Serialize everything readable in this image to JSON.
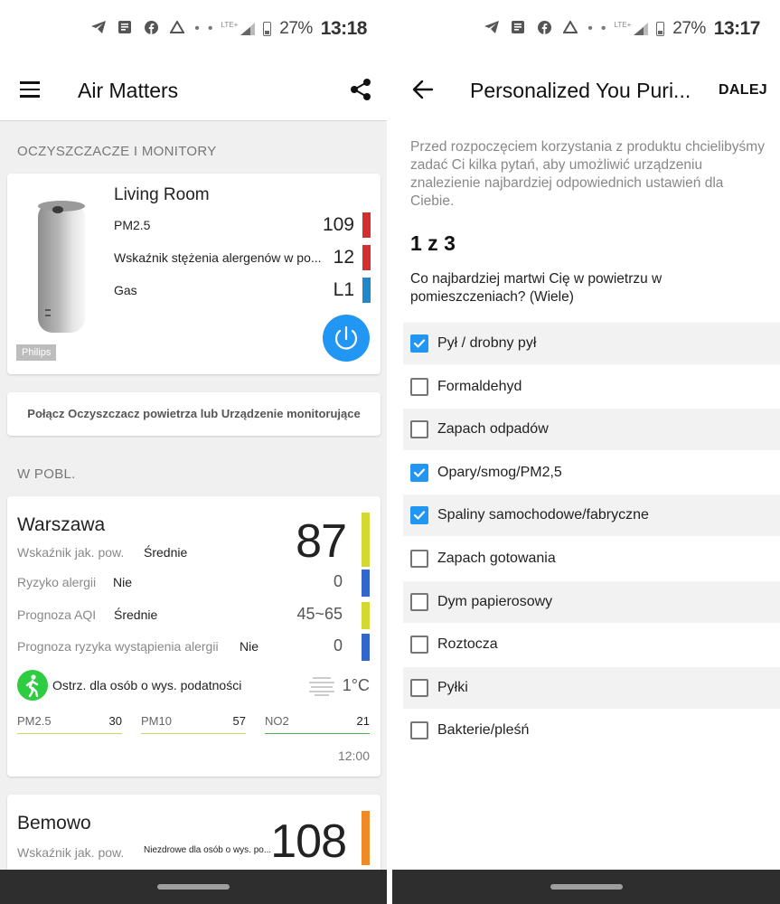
{
  "left": {
    "status": {
      "battery": "27%",
      "time": "13:18",
      "network": "LTE+"
    },
    "app_title": "Air Matters",
    "section_devices": "OCZYSZCZACZE I MONITORY",
    "device": {
      "name": "Living Room",
      "brand": "Philips",
      "rows": [
        {
          "label": "PM2.5",
          "value": "109",
          "color": "#d32f2f"
        },
        {
          "label": "Wskaźnik stężenia alergenów w po...",
          "value": "12",
          "color": "#d32f2f"
        },
        {
          "label": "Gas",
          "value": "L1",
          "color": "#1e88c8"
        }
      ]
    },
    "connect_label": "Połącz Oczyszczacz powietrza lub Urządzenie monitorujące",
    "section_nearby": "W POBL.",
    "city1": {
      "name": "Warszawa",
      "aqi": "87",
      "aqi_color": "#d4d932",
      "rows": [
        {
          "key": "Wskaźnik jak. pow.",
          "value": "Średnie",
          "num": "",
          "color": ""
        },
        {
          "key": "Ryzyko alergii",
          "value": "Nie",
          "num": "0",
          "color": "#3366cc"
        },
        {
          "key": "Prognoza AQI",
          "value": "Średnie",
          "num": "45~65",
          "color": "#d4d932"
        },
        {
          "key": "Prognoza ryzyka wystąpienia alergii",
          "value": "Nie",
          "num": "0",
          "color": "#3366cc"
        }
      ],
      "advice": "Ostrz. dla osób o wys. podatności",
      "temp": "1°C",
      "pollutants": [
        {
          "name": "PM2.5",
          "value": "30",
          "color": "#c5d96b"
        },
        {
          "name": "PM10",
          "value": "57",
          "color": "#c5d96b"
        },
        {
          "name": "NO2",
          "value": "21",
          "color": "#4caf50"
        }
      ],
      "time": "12:00"
    },
    "city2": {
      "name": "Bemowo",
      "aqi": "108",
      "aqi_color": "#f08a24",
      "key": "Wskaźnik jak. pow.",
      "value": "Niezdrowe dla osób o wys. po..."
    }
  },
  "right": {
    "status": {
      "battery": "27%",
      "time": "13:17",
      "network": "LTE+"
    },
    "title": "Personalized You Puri...",
    "next_label": "DALEJ",
    "intro": "Przed rozpoczęciem korzystania z produktu chcielibyśmy zadać Ci kilka pytań, aby umożliwić urządzeniu znalezienie najbardziej odpowiednich ustawień dla Ciebie.",
    "step": "1 z 3",
    "question": "Co najbardziej martwi Cię w powietrzu w pomieszczeniach? (Wiele)",
    "options": [
      {
        "label": "Pył / drobny pył",
        "checked": true
      },
      {
        "label": "Formaldehyd",
        "checked": false
      },
      {
        "label": "Zapach odpadów",
        "checked": false
      },
      {
        "label": "Opary/smog/PM2,5",
        "checked": true
      },
      {
        "label": "Spaliny samochodowe/fabryczne",
        "checked": true
      },
      {
        "label": "Zapach gotowania",
        "checked": false
      },
      {
        "label": "Dym papierosowy",
        "checked": false
      },
      {
        "label": "Roztocza",
        "checked": false
      },
      {
        "label": "Pyłki",
        "checked": false
      },
      {
        "label": "Bakterie/pleśń",
        "checked": false
      }
    ]
  }
}
